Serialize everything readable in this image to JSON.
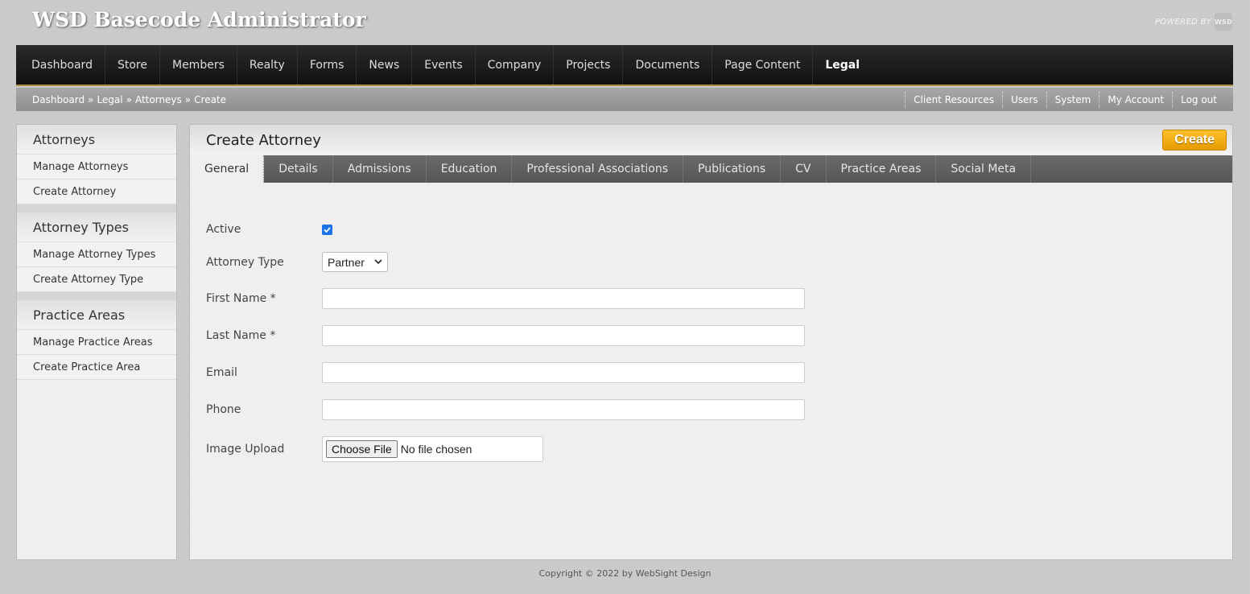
{
  "app": {
    "title": "WSD Basecode Administrator",
    "powered_by": "POWERED BY",
    "logo_text": "WSD"
  },
  "nav": {
    "items": [
      "Dashboard",
      "Store",
      "Members",
      "Realty",
      "Forms",
      "News",
      "Events",
      "Company",
      "Projects",
      "Documents",
      "Page Content",
      "Legal"
    ],
    "active": "Legal"
  },
  "breadcrumb": [
    "Dashboard",
    "»",
    "Legal",
    "»",
    "Attorneys",
    "»",
    "Create"
  ],
  "utility": [
    "Client Resources",
    "Users",
    "System",
    "My Account",
    "Log out"
  ],
  "sidebar": {
    "groups": [
      {
        "title": "Attorneys",
        "items": [
          "Manage Attorneys",
          "Create Attorney"
        ]
      },
      {
        "title": "Attorney Types",
        "items": [
          "Manage Attorney Types",
          "Create Attorney Type"
        ]
      },
      {
        "title": "Practice Areas",
        "items": [
          "Manage Practice Areas",
          "Create Practice Area"
        ]
      }
    ]
  },
  "content": {
    "title": "Create Attorney",
    "create_label": "Create",
    "tabs": [
      "General",
      "Details",
      "Admissions",
      "Education",
      "Professional Associations",
      "Publications",
      "CV",
      "Practice Areas",
      "Social Meta"
    ],
    "active_tab": "General"
  },
  "form": {
    "active_label": "Active",
    "active_checked": true,
    "attorney_type_label": "Attorney Type",
    "attorney_type_value": "Partner",
    "first_name_label": "First Name *",
    "first_name_value": "",
    "last_name_label": "Last Name *",
    "last_name_value": "",
    "email_label": "Email",
    "email_value": "",
    "phone_label": "Phone",
    "phone_value": "",
    "image_label": "Image Upload",
    "choose_file": "Choose File",
    "no_file": "No file chosen"
  },
  "footer": "Copyright © 2022 by WebSight Design",
  "colors": {
    "accent": "#f2a900",
    "nav_bg": "#1a1a1a",
    "checkbox": "#1a73e8"
  }
}
